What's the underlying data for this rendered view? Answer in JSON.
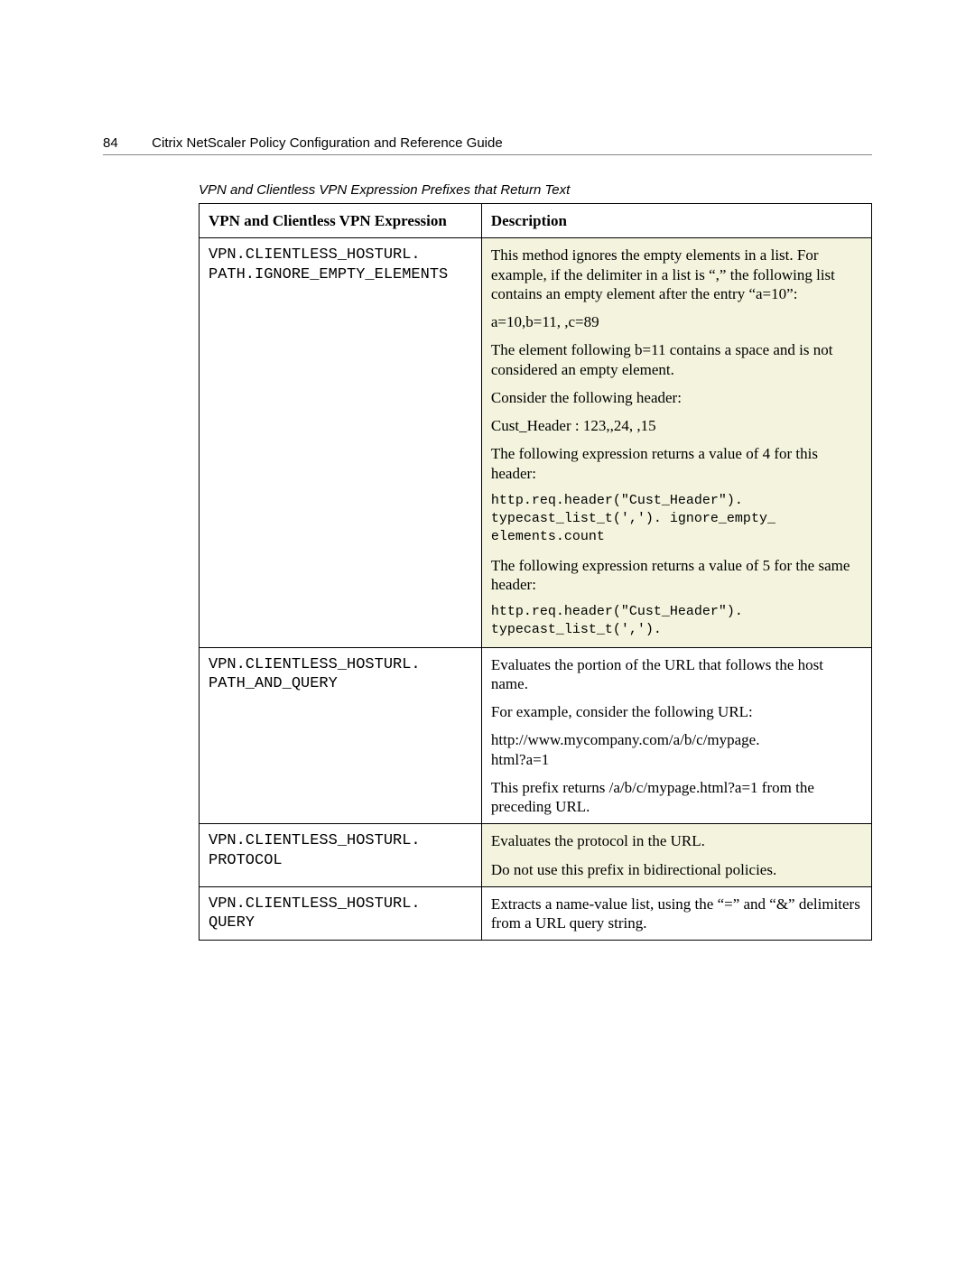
{
  "header": {
    "page_number": "84",
    "title": "Citrix NetScaler Policy Configuration and Reference Guide"
  },
  "caption": "VPN and Clientless VPN Expression Prefixes that Return Text",
  "table": {
    "col1_header": "VPN and Clientless VPN Expression",
    "col2_header": "Description",
    "rows": [
      {
        "expr_lines": [
          "VPN.CLIENTLESS_HOSTURL.",
          "PATH.IGNORE_EMPTY_ELEMENTS"
        ],
        "highlight": true,
        "desc": [
          {
            "type": "text",
            "value": "This method ignores the empty elements in a list. For example, if the delimiter in a list is “,” the following list contains an empty element after the entry “a=10”:"
          },
          {
            "type": "text",
            "value": "a=10,b=11, ,c=89"
          },
          {
            "type": "text",
            "value": "The element following b=11 contains a space and is not considered an empty element."
          },
          {
            "type": "text",
            "value": "Consider the following header:"
          },
          {
            "type": "text",
            "value": "Cust_Header : 123,,24, ,15"
          },
          {
            "type": "text",
            "value": "The following expression returns a value of 4 for this header:"
          },
          {
            "type": "mono",
            "value": "http.req.header(\"Cust_Header\").\ntypecast_list_t(','). ignore_empty_\nelements.count"
          },
          {
            "type": "text",
            "value": "The following expression returns a value of 5 for the same header:"
          },
          {
            "type": "mono",
            "value": "http.req.header(\"Cust_Header\").\ntypecast_list_t(',')."
          }
        ]
      },
      {
        "expr_lines": [
          "VPN.CLIENTLESS_HOSTURL.",
          "PATH_AND_QUERY"
        ],
        "highlight": false,
        "desc": [
          {
            "type": "text",
            "value": "Evaluates the portion of the URL that follows the host name."
          },
          {
            "type": "text",
            "value": "For example, consider the following URL:"
          },
          {
            "type": "text",
            "value": "http://www.mycompany.com/a/b/c/mypage.\nhtml?a=1"
          },
          {
            "type": "text",
            "value": "This prefix returns /a/b/c/mypage.html?a=1 from the preceding URL."
          }
        ]
      },
      {
        "expr_lines": [
          "VPN.CLIENTLESS_HOSTURL.",
          "PROTOCOL"
        ],
        "highlight": true,
        "desc": [
          {
            "type": "text",
            "value": "Evaluates the protocol in the URL."
          },
          {
            "type": "text",
            "value": "Do not use this prefix in bidirectional policies."
          }
        ]
      },
      {
        "expr_lines": [
          "VPN.CLIENTLESS_HOSTURL.",
          "QUERY"
        ],
        "highlight": false,
        "desc": [
          {
            "type": "text",
            "value": "Extracts a name-value list, using the “=” and “&” delimiters from a URL query string."
          }
        ]
      }
    ]
  }
}
